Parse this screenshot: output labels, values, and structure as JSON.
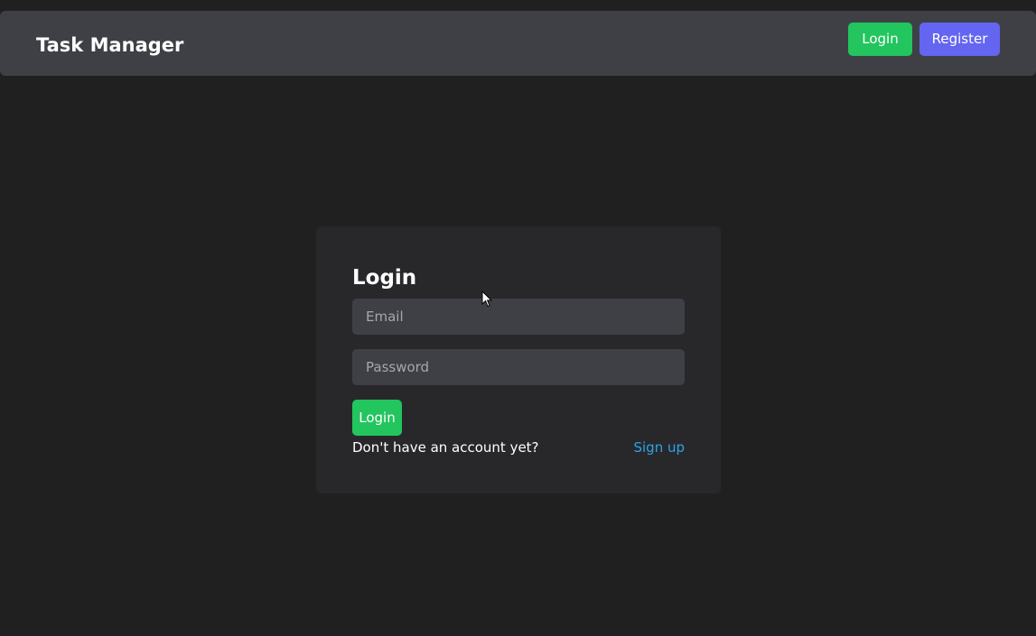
{
  "header": {
    "title": "Task Manager",
    "login_label": "Login",
    "register_label": "Register"
  },
  "login_form": {
    "title": "Login",
    "email_placeholder": "Email",
    "password_placeholder": "Password",
    "submit_label": "Login",
    "signup_prompt": "Don't have an account yet?",
    "signup_link": "Sign up"
  },
  "colors": {
    "background": "#202020",
    "header_bg": "#3f4046",
    "card_bg": "#28282b",
    "input_bg": "#3f4046",
    "success_green": "#22c55e",
    "register_purple": "#6466f1",
    "link_blue": "#2ea3e8"
  }
}
